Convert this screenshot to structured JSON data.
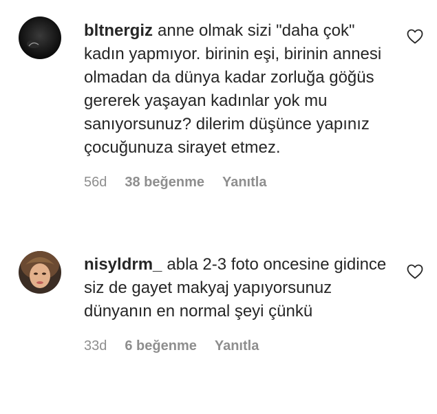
{
  "comments": [
    {
      "username": "bltnergiz",
      "text": "anne olmak sizi \"daha çok\" kadın yapmıyor. birinin eşi, birinin annesi olmadan da dünya kadar zorluğa göğüs gererek yaşayan kadınlar yok mu sanıyorsunuz? dilerim düşünce yapınız çocuğunuza sirayet etmez.",
      "age": "56d",
      "likes": "38 beğenme",
      "reply": "Yanıtla",
      "avatar_icon": "profile-photo"
    },
    {
      "username": "nisyldrm_",
      "text": "abla 2-3 foto oncesine gidince siz de gayet makyaj yapıyorsunuz dünyanın en normal şeyi çünkü",
      "age": "33d",
      "likes": "6 beğenme",
      "reply": "Yanıtla",
      "avatar_icon": "profile-photo"
    }
  ],
  "like_icon": "heart-outline-icon",
  "colors": {
    "text": "#262626",
    "meta": "#8e8e8e"
  }
}
